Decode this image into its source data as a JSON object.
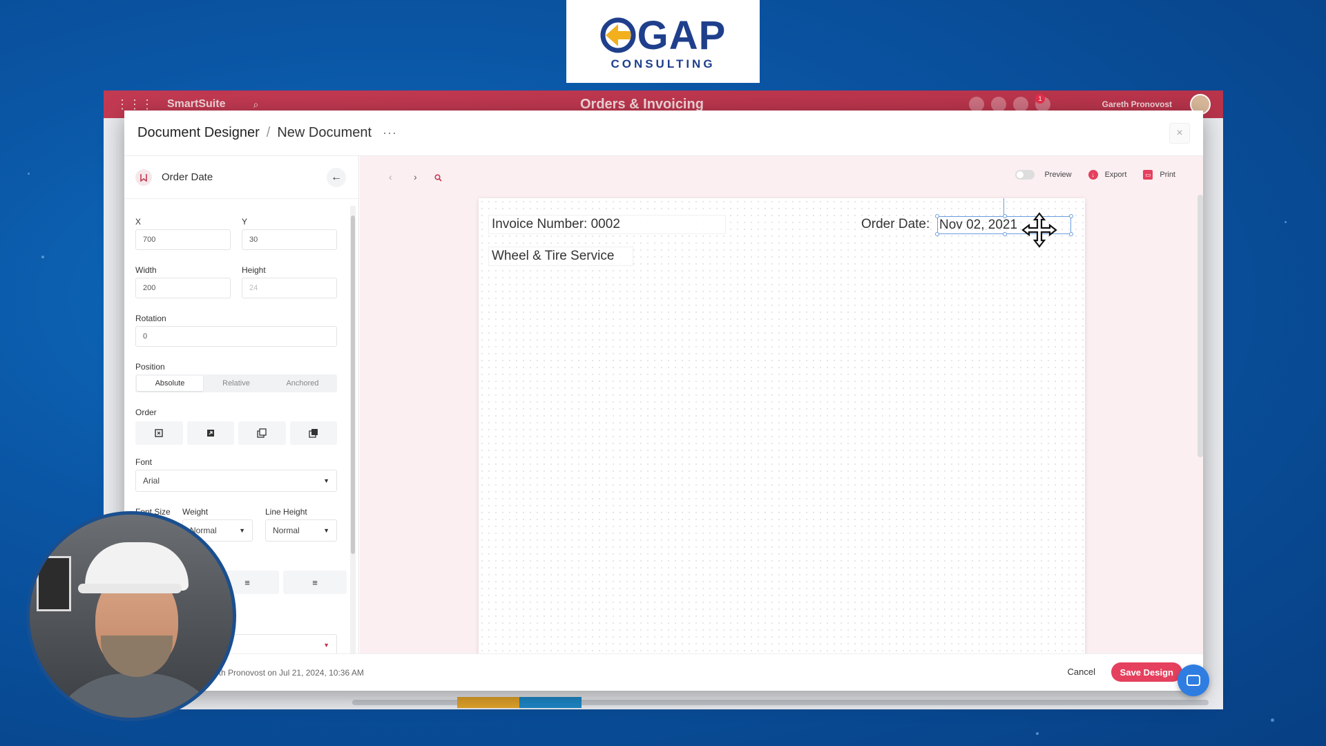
{
  "logo": {
    "text": "GAP",
    "subtitle": "CONSULTING"
  },
  "background_app": {
    "app_name": "SmartSuite",
    "workspace_title": "Orders & Invoicing",
    "user_name": "Gareth Pronovost",
    "notification_count": "1"
  },
  "modal": {
    "breadcrumb": {
      "main": "Document Designer",
      "separator": "/",
      "current": "New Document",
      "more": "···"
    },
    "close_icon": "×"
  },
  "left_panel": {
    "field_title": "Order Date",
    "back_icon": "←",
    "x_label": "X",
    "x_value": "700",
    "y_label": "Y",
    "y_value": "30",
    "width_label": "Width",
    "width_value": "200",
    "height_label": "Height",
    "height_value": "24",
    "rotation_label": "Rotation",
    "rotation_value": "0",
    "position_label": "Position",
    "position_options": [
      "Absolute",
      "Relative",
      "Anchored"
    ],
    "position_selected": "Absolute",
    "order_label": "Order",
    "font_label": "Font",
    "font_value": "Arial",
    "font_size_label": "Font Size",
    "weight_label": "Weight",
    "weight_value": "Normal",
    "line_height_label": "Line Height",
    "line_height_value": "Normal"
  },
  "canvas": {
    "prev_icon": "‹",
    "next_icon": "›",
    "zoom_icon": "search-icon",
    "preview_label": "Preview",
    "export_label": "Export",
    "print_label": "Print",
    "fields": {
      "invoice_number": "Invoice Number: 0002",
      "service_name": "Wheel & Tire Service",
      "order_date_label": "Order Date:",
      "order_date_value": "Nov 02, 2021"
    }
  },
  "footer": {
    "meta": "eth Pronovost on Jul 21, 2024, 10:36 AM",
    "cancel_label": "Cancel",
    "save_label": "Save Design"
  },
  "colors": {
    "accent": "#e5405e",
    "topbar": "#c23a52",
    "brand_blue": "#1f3f8c",
    "selection": "#6a9ce0"
  }
}
